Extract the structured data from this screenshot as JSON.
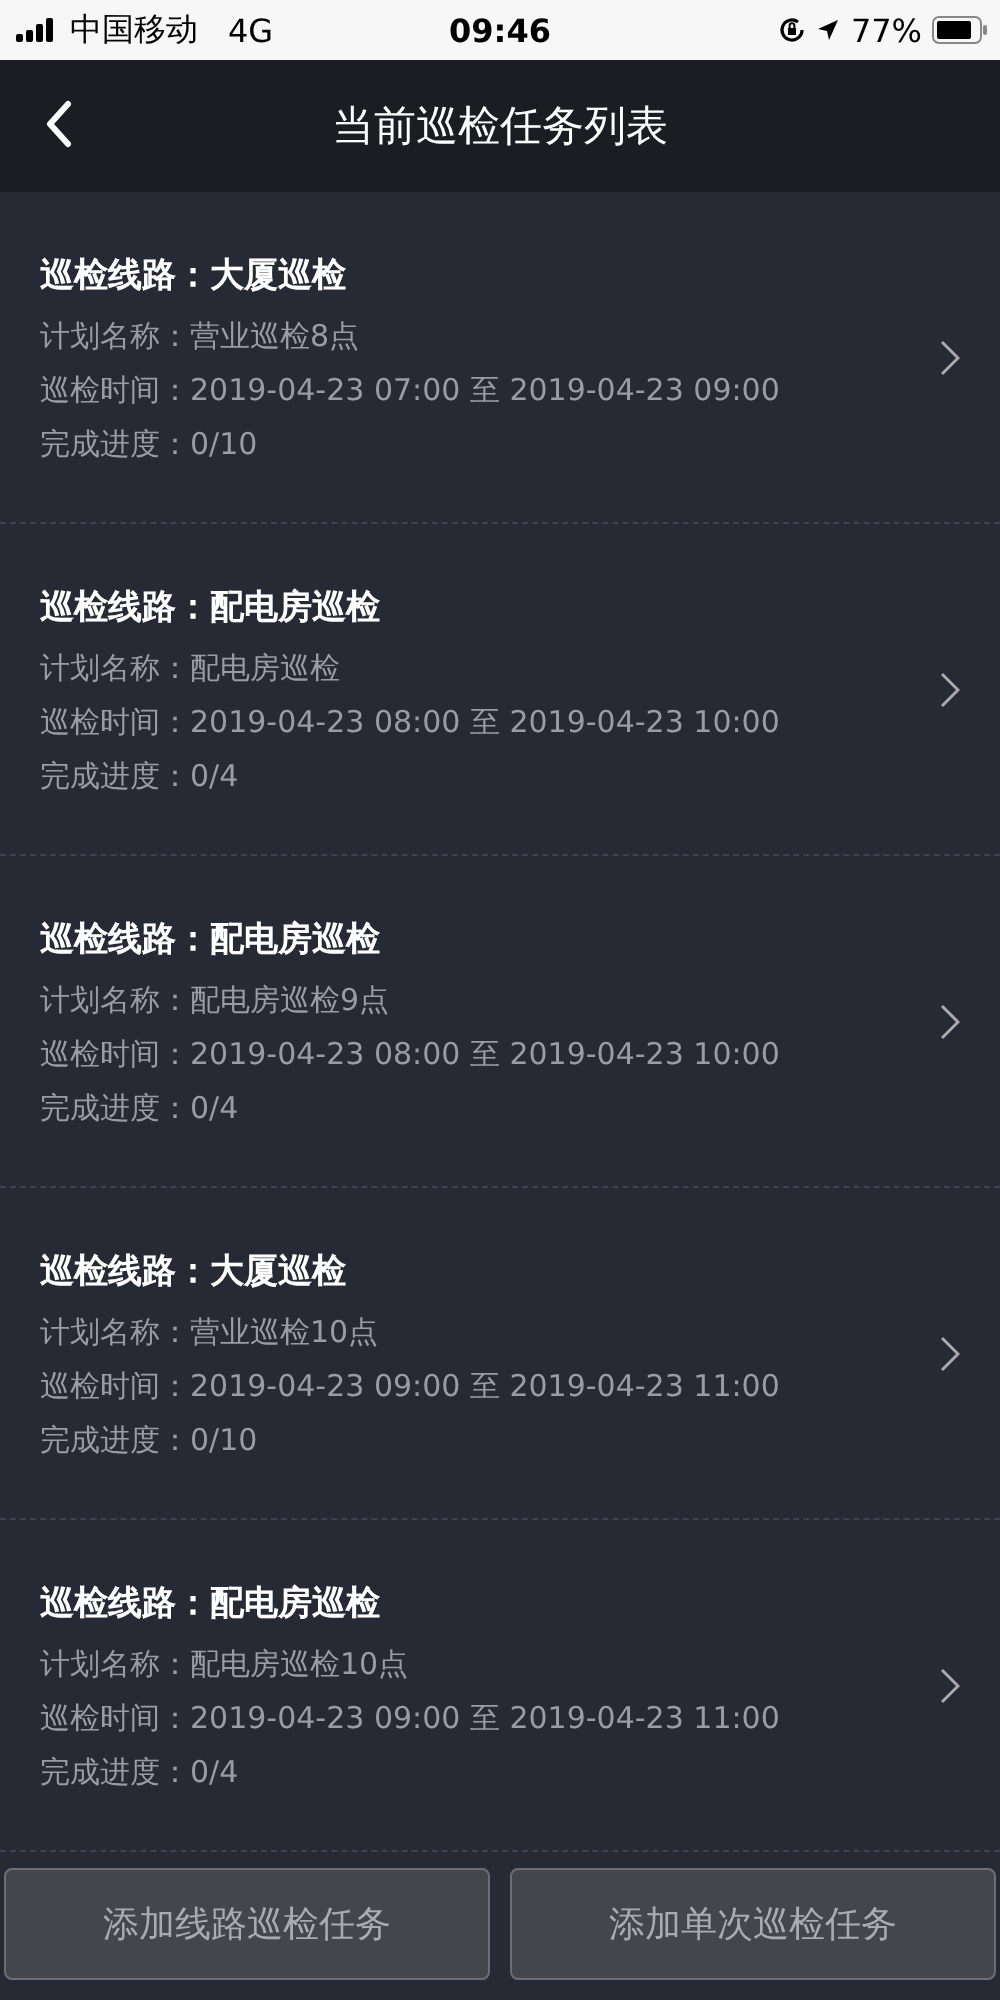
{
  "status_bar": {
    "carrier": "中国移动",
    "network": "4G",
    "time": "09:46",
    "battery": "77%"
  },
  "header": {
    "title": "当前巡检任务列表"
  },
  "tasks": [
    {
      "route": "巡检线路：大厦巡检",
      "plan": "计划名称：营业巡检8点",
      "time": "巡检时间：2019-04-23 07:00 至 2019-04-23 09:00",
      "progress": "完成进度：0/10"
    },
    {
      "route": "巡检线路：配电房巡检",
      "plan": "计划名称：配电房巡检",
      "time": "巡检时间：2019-04-23 08:00 至 2019-04-23 10:00",
      "progress": "完成进度：0/4"
    },
    {
      "route": "巡检线路：配电房巡检",
      "plan": "计划名称：配电房巡检9点",
      "time": "巡检时间：2019-04-23 08:00 至 2019-04-23 10:00",
      "progress": "完成进度：0/4"
    },
    {
      "route": "巡检线路：大厦巡检",
      "plan": "计划名称：营业巡检10点",
      "time": "巡检时间：2019-04-23 09:00 至 2019-04-23 11:00",
      "progress": "完成进度：0/10"
    },
    {
      "route": "巡检线路：配电房巡检",
      "plan": "计划名称：配电房巡检10点",
      "time": "巡检时间：2019-04-23 09:00 至 2019-04-23 11:00",
      "progress": "完成进度：0/4"
    }
  ],
  "buttons": [
    "添加线路巡检任务",
    "添加单次巡检任务"
  ]
}
